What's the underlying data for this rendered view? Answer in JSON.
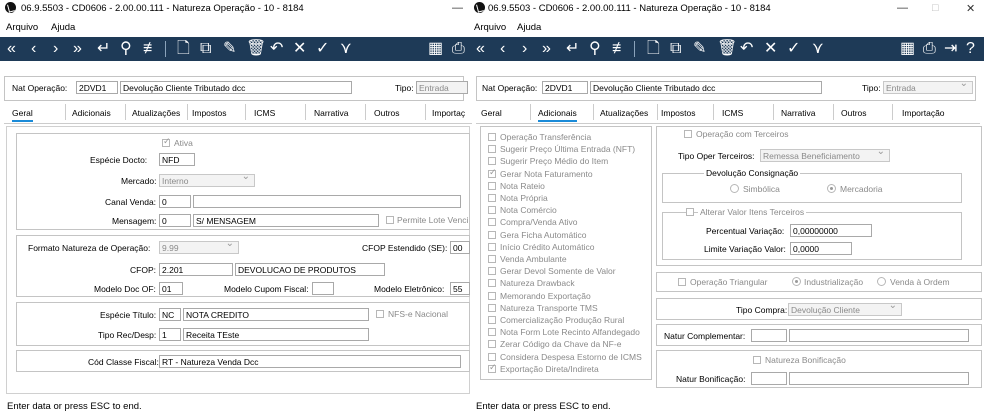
{
  "window": {
    "title": "06.9.5503 - CD0606 - 2.00.00.111 - Natureza Operação - 10 - 8184",
    "minimize_glyph": "—",
    "maximize_glyph": "□",
    "close_glyph": "✕"
  },
  "menu": {
    "arquivo": "Arquivo",
    "ajuda": "Ajuda"
  },
  "toolbar": {
    "icons": [
      "first-icon",
      "prev-icon",
      "next-icon",
      "last-icon",
      "enter-icon",
      "search-icon",
      "filter-icon",
      "new-icon",
      "copy-icon",
      "edit-icon",
      "delete-icon",
      "undo-icon",
      "cancel-icon",
      "confirm-icon",
      "confirm-all-icon",
      "calculator-icon",
      "print-icon",
      "exit-icon",
      "help-icon"
    ],
    "glyphs": {
      "first": "«",
      "prev": "‹",
      "next": "›",
      "last": "»",
      "enter": "↵",
      "search": "⚲",
      "filter": "≢",
      "new": "🗋",
      "copy": "⧉",
      "edit": "✎",
      "delete": "🗑",
      "undo": "↶",
      "cancel": "✕",
      "confirm": "✓",
      "confirm_all": "⋎",
      "calc": "▦",
      "print": "⎙",
      "exit": "⇥",
      "help": "?"
    }
  },
  "header": {
    "nat_label": "Nat Operação:",
    "nat_code": "2DVD1",
    "nat_desc": "Devolução Cliente Tributado dcc",
    "tipo_label": "Tipo:",
    "tipo_value": "Entrada"
  },
  "tabs": [
    "Geral",
    "Adicionais",
    "Atualizações",
    "Impostos",
    "ICMS",
    "Narrativa",
    "Outros",
    "Importação"
  ],
  "tabs_w1_last": "Importaç",
  "geral": {
    "ativa": "Ativa",
    "especie_label": "Espécie Docto:",
    "especie_value": "NFD",
    "mercado_label": "Mercado:",
    "mercado_value": "Interno",
    "canal_label": "Canal Venda:",
    "canal_value": "0",
    "mensagem_label": "Mensagem:",
    "mensagem_code": "0",
    "mensagem_desc": "S/ MENSAGEM",
    "permite_lote": "Permite Lote Venci",
    "formato_label": "Formato Natureza de Operação:",
    "formato_value": "9.99",
    "cfop_est_label": "CFOP Estendido (SE):",
    "cfop_est_value": "00",
    "cfop_label": "CFOP:",
    "cfop_value": "2.201",
    "cfop_desc": "DEVOLUCAO DE PRODUTOS",
    "modelo_doc_label": "Modelo Doc OF:",
    "modelo_doc_value": "01",
    "modelo_cupom_label": "Modelo Cupom Fiscal:",
    "modelo_eletr_label": "Modelo Eletrônico:",
    "modelo_eletr_value": "55",
    "especie_titulo_label": "Espécie Título:",
    "especie_titulo_code": "NC",
    "especie_titulo_desc": "NOTA CREDITO",
    "nfse": "NFS-e Nacional",
    "tipo_rec_label": "Tipo Rec/Desp:",
    "tipo_rec_code": "1",
    "tipo_rec_desc": "Receita TEste",
    "cod_classe_label": "Cód Classe Fiscal:",
    "cod_classe_value": "RT - Natureza Venda Dcc"
  },
  "adicionais": {
    "checks": [
      {
        "label": "Operação Transferência",
        "checked": false
      },
      {
        "label": "Sugerir Preço Última Entrada (NFT)",
        "checked": false
      },
      {
        "label": "Sugerir Preço Médio do Item",
        "checked": false
      },
      {
        "label": "Gerar Nota Faturamento",
        "checked": true
      },
      {
        "label": "Nota Rateio",
        "checked": false
      },
      {
        "label": "Nota Própria",
        "checked": false
      },
      {
        "label": "Nota Comércio",
        "checked": false
      },
      {
        "label": "Compra/Venda Ativo",
        "checked": false
      },
      {
        "label": "Gera Ficha Automático",
        "checked": false
      },
      {
        "label": "Início Crédito Automático",
        "checked": false
      },
      {
        "label": "Venda Ambulante",
        "checked": false
      },
      {
        "label": "Gerar Devol Somente de Valor",
        "checked": false
      },
      {
        "label": "Natureza Drawback",
        "checked": false
      },
      {
        "label": "Memorando Exportação",
        "checked": false
      },
      {
        "label": "Natureza Transporte TMS",
        "checked": false
      },
      {
        "label": "Comercialização Produção Rural",
        "checked": false
      },
      {
        "label": "Nota Form Lote Recinto Alfandegado",
        "checked": false
      },
      {
        "label": "Zerar Código da Chave da NF-e",
        "checked": false
      },
      {
        "label": "Considera Despesa Estorno de ICMS",
        "checked": false
      },
      {
        "label": "Exportação Direta/Indireta",
        "checked": true
      }
    ],
    "op_terceiros": "Operação com Terceiros",
    "tipo_oper_label": "Tipo Oper Terceiros:",
    "tipo_oper_value": "Remessa Beneficiamento",
    "devol_consig": "Devolução Consignação",
    "simbolica": "Simbólica",
    "mercadoria": "Mercadoria",
    "alterar_valor": "Alterar Valor Itens Terceiros",
    "perc_label": "Percentual Variação:",
    "perc_value": "0,00000000",
    "limite_label": "Limite Variação Valor:",
    "limite_value": "0,0000",
    "op_triangular": "Operação Triangular",
    "industrializacao": "Industrialização",
    "venda_ordem": "Venda à Ordem",
    "tipo_compra_label": "Tipo Compra:",
    "tipo_compra_value": "Devolução Cliente",
    "natur_compl_label": "Natur Complementar:",
    "natureza_bonif": "Natureza Bonificação",
    "natur_bonif_label": "Natur Bonificação:"
  },
  "status": "Enter data or press ESC to end."
}
